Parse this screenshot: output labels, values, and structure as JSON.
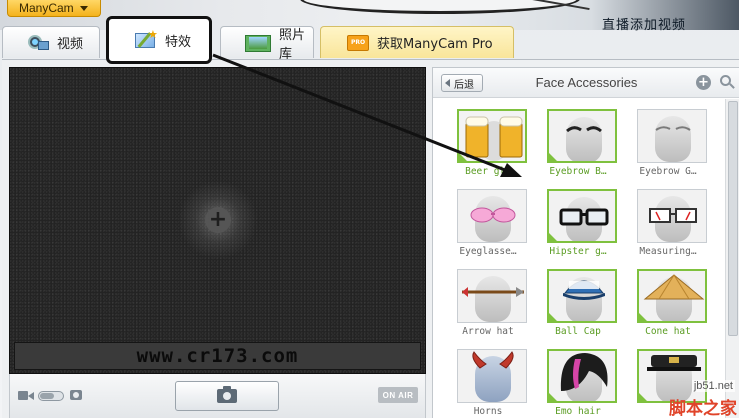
{
  "app": {
    "brand": "ManyCam"
  },
  "background": {
    "text": "直播添加视频"
  },
  "tabs": [
    {
      "label": "视频",
      "icon": "webcam-icon"
    },
    {
      "label": "特效",
      "icon": "effects-icon"
    },
    {
      "label": "照片库",
      "icon": "gallery-icon"
    },
    {
      "label": "获取ManyCam Pro",
      "icon": "pro-badge-icon",
      "badge": "PRO"
    }
  ],
  "video": {
    "watermark": "www.cr173.com"
  },
  "controls": {
    "onair": "ON AIR"
  },
  "panel": {
    "back_label": "后退",
    "title": "Face Accessories",
    "items": [
      {
        "label": "Beer gl…",
        "green": true
      },
      {
        "label": "Eyebrow B…",
        "green": true
      },
      {
        "label": "Eyebrow G…",
        "green": false
      },
      {
        "label": "Eyeglasse…",
        "green": false
      },
      {
        "label": "Hipster g…",
        "green": true
      },
      {
        "label": "Measuring…",
        "green": false
      },
      {
        "label": "Arrow hat",
        "green": false
      },
      {
        "label": "Ball Cap",
        "green": true
      },
      {
        "label": "Cone hat",
        "green": true
      },
      {
        "label": "Horns",
        "green": false
      },
      {
        "label": "Emo hair",
        "green": true
      },
      {
        "label": "",
        "green": false
      }
    ]
  },
  "site": {
    "url": "jb51.net",
    "name": "脚本之家"
  },
  "colors": {
    "accent": "#f4b21c",
    "selected_border": "#7fc13e",
    "label_green": "#5a9c22",
    "annotation": "#111111"
  }
}
